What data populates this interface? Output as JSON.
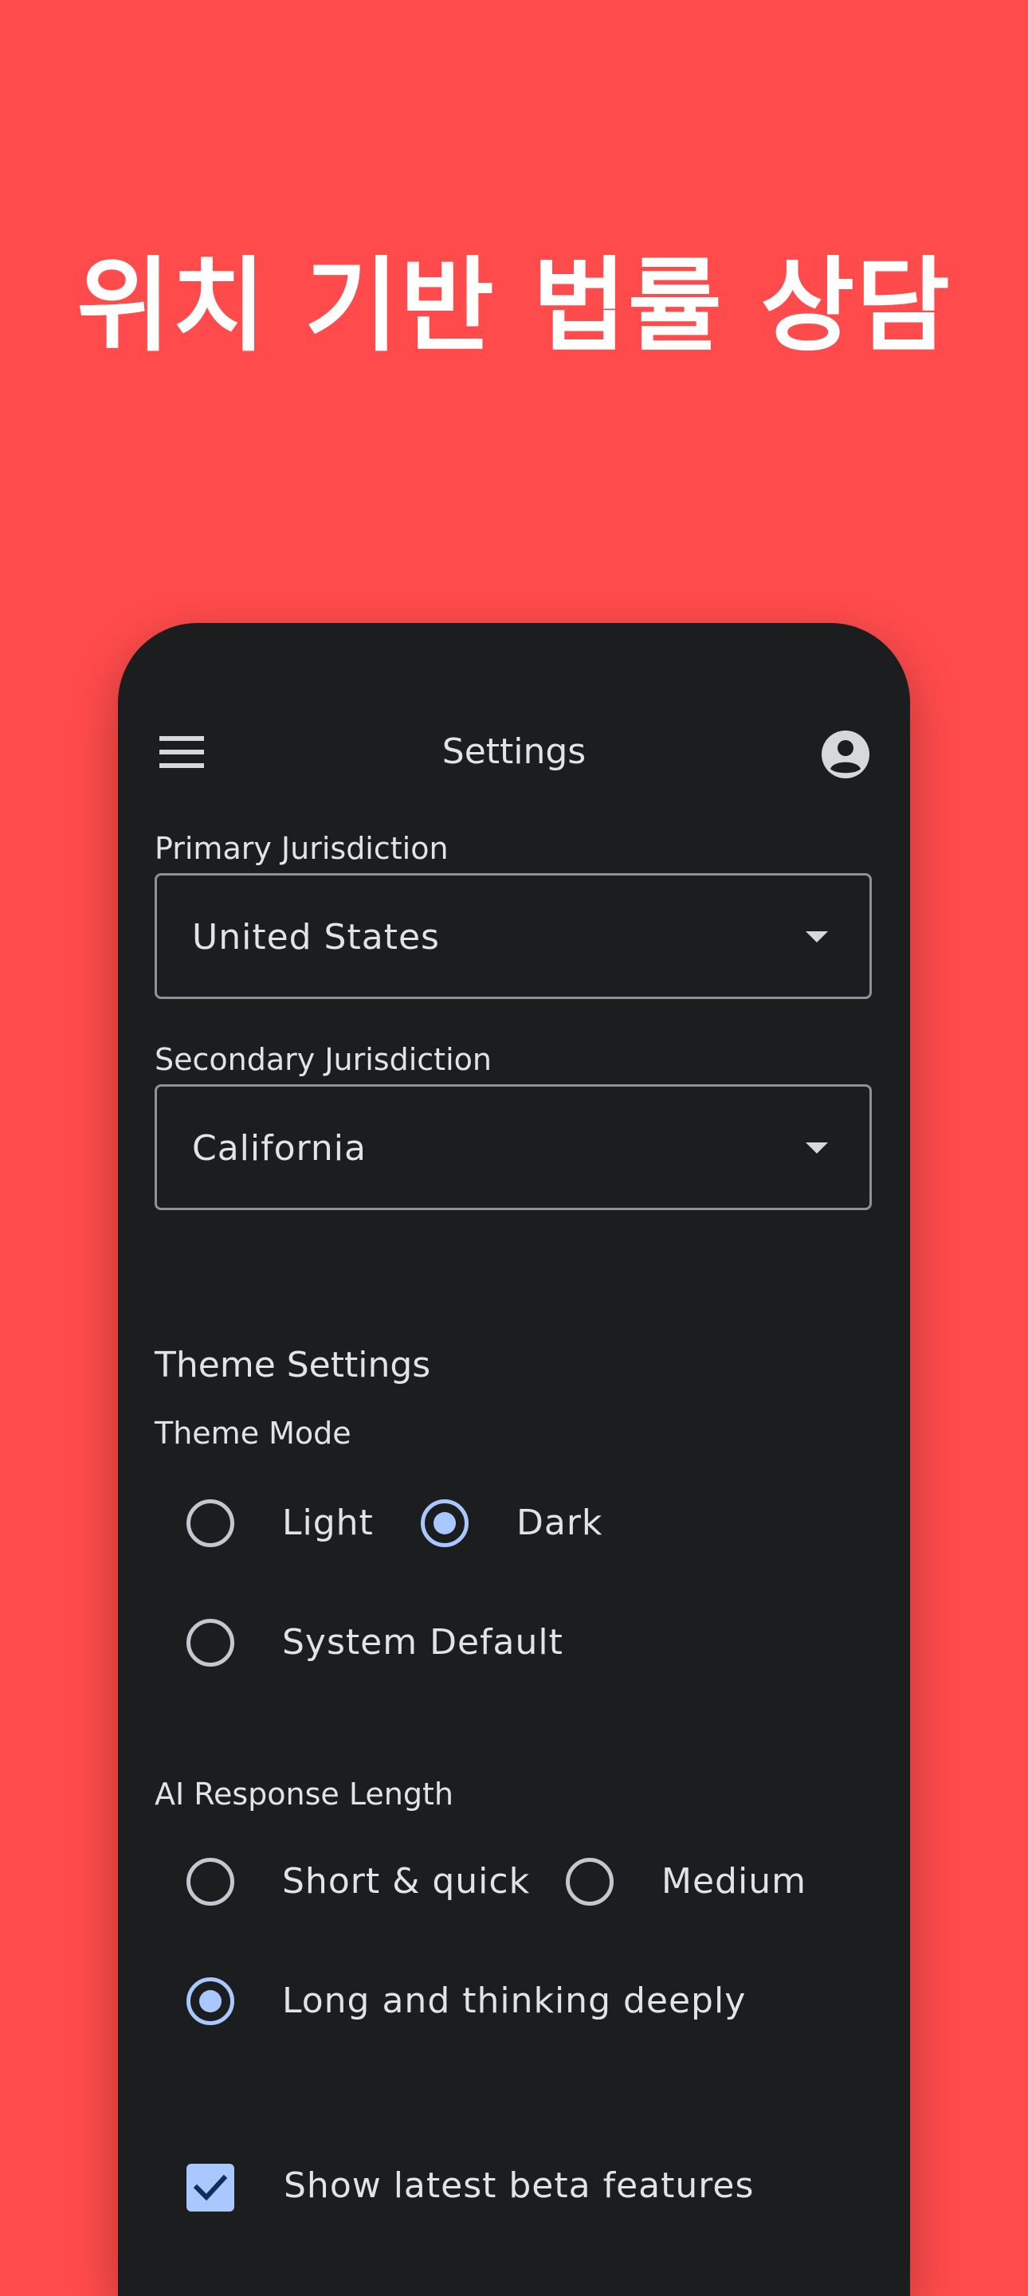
{
  "headline": "위치 기반 법률 상담",
  "app_bar": {
    "title": "Settings",
    "menu_icon": "hamburger-menu-icon",
    "account_icon": "account-circle-icon"
  },
  "jurisdiction": {
    "primary": {
      "label": "Primary Jurisdiction",
      "value": "United States"
    },
    "secondary": {
      "label": "Secondary Jurisdiction",
      "value": "California"
    }
  },
  "theme": {
    "section_title": "Theme Settings",
    "mode_label": "Theme Mode",
    "options": [
      {
        "label": "Light",
        "selected": false
      },
      {
        "label": "Dark",
        "selected": true
      },
      {
        "label": "System Default",
        "selected": false
      }
    ]
  },
  "ai_response": {
    "label": "AI Response Length",
    "options": [
      {
        "label": "Short & quick",
        "selected": false
      },
      {
        "label": "Medium",
        "selected": false
      },
      {
        "label": "Long and thinking deeply",
        "selected": true
      }
    ]
  },
  "beta": {
    "label": "Show latest beta features",
    "checked": true
  },
  "colors": {
    "background": "#FF4B4B",
    "surface": "#1C1D1F",
    "accent": "#A8C8FF",
    "text": "#E3E3E6",
    "outline": "#8D9199"
  }
}
